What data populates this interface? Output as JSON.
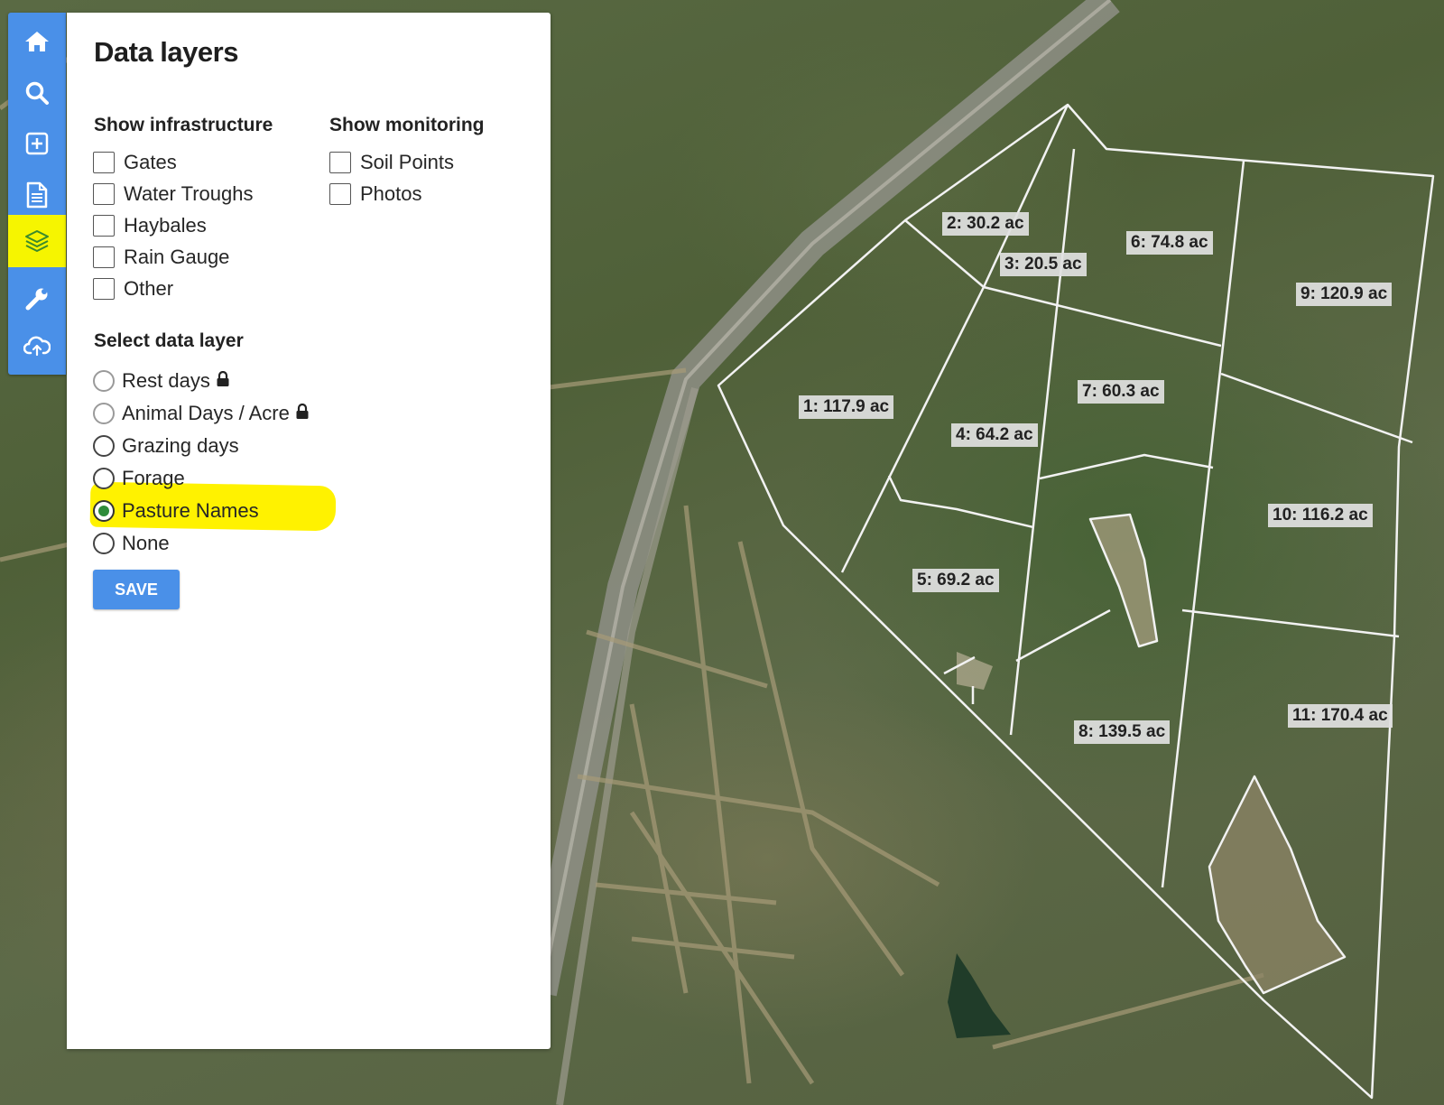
{
  "toolbar": {
    "items": [
      {
        "icon": "home-icon"
      },
      {
        "icon": "search-icon"
      },
      {
        "icon": "add-icon"
      },
      {
        "icon": "document-icon"
      },
      {
        "icon": "layers-icon",
        "active": true
      },
      {
        "icon": "wrench-icon"
      },
      {
        "icon": "cloud-sync-icon"
      }
    ],
    "accent_color": "#4a90e8",
    "active_highlight_color": "#f6f500"
  },
  "panel": {
    "title": "Data layers",
    "infrastructure": {
      "heading": "Show infrastructure",
      "items": [
        {
          "label": "Gates",
          "checked": false
        },
        {
          "label": "Water Troughs",
          "checked": false
        },
        {
          "label": "Haybales",
          "checked": false
        },
        {
          "label": "Rain Gauge",
          "checked": false
        },
        {
          "label": "Other",
          "checked": false
        }
      ]
    },
    "monitoring": {
      "heading": "Show monitoring",
      "items": [
        {
          "label": "Soil Points",
          "checked": false
        },
        {
          "label": "Photos",
          "checked": false
        }
      ]
    },
    "data_layer": {
      "heading": "Select data layer",
      "options": [
        {
          "label": "Rest days",
          "locked": true,
          "selected": false
        },
        {
          "label": "Animal Days / Acre",
          "locked": true,
          "selected": false
        },
        {
          "label": "Grazing days",
          "locked": false,
          "selected": false
        },
        {
          "label": "Forage",
          "locked": false,
          "selected": false
        },
        {
          "label": "Pasture Names",
          "locked": false,
          "selected": true
        },
        {
          "label": "None",
          "locked": false,
          "selected": false
        }
      ],
      "selected_color": "#2e8b3a"
    },
    "save_label": "SAVE"
  },
  "map": {
    "pastures": [
      {
        "label": "1: 117.9 ac"
      },
      {
        "label": "2: 30.2 ac"
      },
      {
        "label": "3: 20.5 ac"
      },
      {
        "label": "4: 64.2 ac"
      },
      {
        "label": "5: 69.2 ac"
      },
      {
        "label": "6: 74.8 ac"
      },
      {
        "label": "7: 60.3 ac"
      },
      {
        "label": "8: 139.5 ac"
      },
      {
        "label": "9: 120.9 ac"
      },
      {
        "label": "10: 116.2 ac"
      },
      {
        "label": "11: 170.4 ac"
      }
    ],
    "boundary_color": "#ffffff"
  }
}
